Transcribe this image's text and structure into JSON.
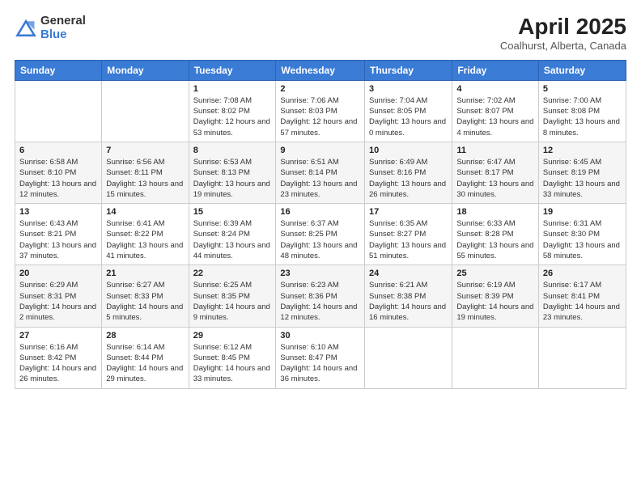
{
  "logo": {
    "general": "General",
    "blue": "Blue"
  },
  "title": {
    "month_year": "April 2025",
    "location": "Coalhurst, Alberta, Canada"
  },
  "days_of_week": [
    "Sunday",
    "Monday",
    "Tuesday",
    "Wednesday",
    "Thursday",
    "Friday",
    "Saturday"
  ],
  "weeks": [
    [
      {
        "date": "",
        "info": ""
      },
      {
        "date": "",
        "info": ""
      },
      {
        "date": "1",
        "info": "Sunrise: 7:08 AM\nSunset: 8:02 PM\nDaylight: 12 hours and 53 minutes."
      },
      {
        "date": "2",
        "info": "Sunrise: 7:06 AM\nSunset: 8:03 PM\nDaylight: 12 hours and 57 minutes."
      },
      {
        "date": "3",
        "info": "Sunrise: 7:04 AM\nSunset: 8:05 PM\nDaylight: 13 hours and 0 minutes."
      },
      {
        "date": "4",
        "info": "Sunrise: 7:02 AM\nSunset: 8:07 PM\nDaylight: 13 hours and 4 minutes."
      },
      {
        "date": "5",
        "info": "Sunrise: 7:00 AM\nSunset: 8:08 PM\nDaylight: 13 hours and 8 minutes."
      }
    ],
    [
      {
        "date": "6",
        "info": "Sunrise: 6:58 AM\nSunset: 8:10 PM\nDaylight: 13 hours and 12 minutes."
      },
      {
        "date": "7",
        "info": "Sunrise: 6:56 AM\nSunset: 8:11 PM\nDaylight: 13 hours and 15 minutes."
      },
      {
        "date": "8",
        "info": "Sunrise: 6:53 AM\nSunset: 8:13 PM\nDaylight: 13 hours and 19 minutes."
      },
      {
        "date": "9",
        "info": "Sunrise: 6:51 AM\nSunset: 8:14 PM\nDaylight: 13 hours and 23 minutes."
      },
      {
        "date": "10",
        "info": "Sunrise: 6:49 AM\nSunset: 8:16 PM\nDaylight: 13 hours and 26 minutes."
      },
      {
        "date": "11",
        "info": "Sunrise: 6:47 AM\nSunset: 8:17 PM\nDaylight: 13 hours and 30 minutes."
      },
      {
        "date": "12",
        "info": "Sunrise: 6:45 AM\nSunset: 8:19 PM\nDaylight: 13 hours and 33 minutes."
      }
    ],
    [
      {
        "date": "13",
        "info": "Sunrise: 6:43 AM\nSunset: 8:21 PM\nDaylight: 13 hours and 37 minutes."
      },
      {
        "date": "14",
        "info": "Sunrise: 6:41 AM\nSunset: 8:22 PM\nDaylight: 13 hours and 41 minutes."
      },
      {
        "date": "15",
        "info": "Sunrise: 6:39 AM\nSunset: 8:24 PM\nDaylight: 13 hours and 44 minutes."
      },
      {
        "date": "16",
        "info": "Sunrise: 6:37 AM\nSunset: 8:25 PM\nDaylight: 13 hours and 48 minutes."
      },
      {
        "date": "17",
        "info": "Sunrise: 6:35 AM\nSunset: 8:27 PM\nDaylight: 13 hours and 51 minutes."
      },
      {
        "date": "18",
        "info": "Sunrise: 6:33 AM\nSunset: 8:28 PM\nDaylight: 13 hours and 55 minutes."
      },
      {
        "date": "19",
        "info": "Sunrise: 6:31 AM\nSunset: 8:30 PM\nDaylight: 13 hours and 58 minutes."
      }
    ],
    [
      {
        "date": "20",
        "info": "Sunrise: 6:29 AM\nSunset: 8:31 PM\nDaylight: 14 hours and 2 minutes."
      },
      {
        "date": "21",
        "info": "Sunrise: 6:27 AM\nSunset: 8:33 PM\nDaylight: 14 hours and 5 minutes."
      },
      {
        "date": "22",
        "info": "Sunrise: 6:25 AM\nSunset: 8:35 PM\nDaylight: 14 hours and 9 minutes."
      },
      {
        "date": "23",
        "info": "Sunrise: 6:23 AM\nSunset: 8:36 PM\nDaylight: 14 hours and 12 minutes."
      },
      {
        "date": "24",
        "info": "Sunrise: 6:21 AM\nSunset: 8:38 PM\nDaylight: 14 hours and 16 minutes."
      },
      {
        "date": "25",
        "info": "Sunrise: 6:19 AM\nSunset: 8:39 PM\nDaylight: 14 hours and 19 minutes."
      },
      {
        "date": "26",
        "info": "Sunrise: 6:17 AM\nSunset: 8:41 PM\nDaylight: 14 hours and 23 minutes."
      }
    ],
    [
      {
        "date": "27",
        "info": "Sunrise: 6:16 AM\nSunset: 8:42 PM\nDaylight: 14 hours and 26 minutes."
      },
      {
        "date": "28",
        "info": "Sunrise: 6:14 AM\nSunset: 8:44 PM\nDaylight: 14 hours and 29 minutes."
      },
      {
        "date": "29",
        "info": "Sunrise: 6:12 AM\nSunset: 8:45 PM\nDaylight: 14 hours and 33 minutes."
      },
      {
        "date": "30",
        "info": "Sunrise: 6:10 AM\nSunset: 8:47 PM\nDaylight: 14 hours and 36 minutes."
      },
      {
        "date": "",
        "info": ""
      },
      {
        "date": "",
        "info": ""
      },
      {
        "date": "",
        "info": ""
      }
    ]
  ]
}
